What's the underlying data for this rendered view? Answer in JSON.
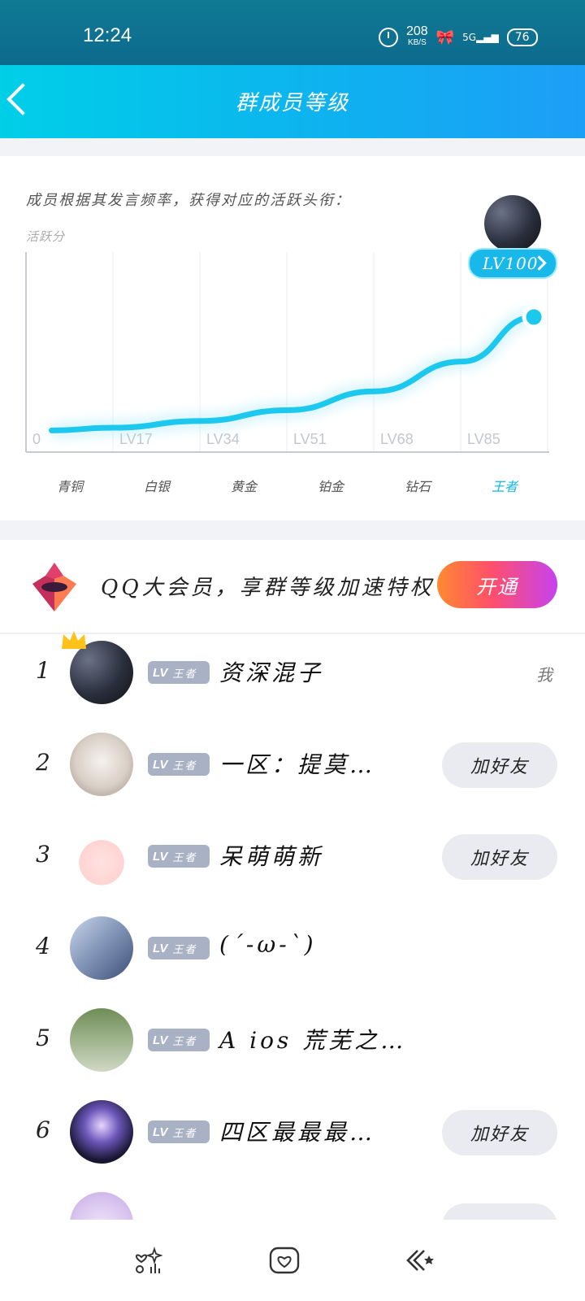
{
  "status_bar": {
    "time": "12:24",
    "net_speed": "208",
    "net_unit": "KB/S",
    "network": "5G",
    "battery": "76"
  },
  "header": {
    "title": "群成员等级"
  },
  "chart_section": {
    "description": "成员根据其发言频率，获得对应的活跃头衔：",
    "badge": "LV100"
  },
  "chart_data": {
    "type": "line",
    "ylabel": "活跃分",
    "x_tick_labels": [
      "0",
      "LV17",
      "LV34",
      "LV51",
      "LV68",
      "LV85"
    ],
    "categories": [
      "青铜",
      "白银",
      "黄金",
      "铂金",
      "钻石",
      "王者"
    ],
    "active_category": "王者",
    "x": [
      5,
      17,
      34,
      51,
      68,
      85,
      99
    ],
    "y": [
      1,
      3,
      8,
      16,
      30,
      52,
      85
    ],
    "xlim": [
      0,
      102
    ],
    "ylim": [
      0,
      100
    ],
    "grid": "vertical",
    "endpoint_label": "LV100",
    "colors": {
      "line": "#1cc8ee",
      "active": "#10b7e6"
    }
  },
  "vip": {
    "text": "QQ大会员，享群等级加速特权",
    "button": "开通"
  },
  "members": [
    {
      "rank": "1",
      "level": "LV",
      "title": "王者",
      "name": "资深混子",
      "action": "我",
      "self": true
    },
    {
      "rank": "2",
      "level": "LV",
      "title": "王者",
      "name": "一区：提莫…",
      "action": "加好友",
      "self": false
    },
    {
      "rank": "3",
      "level": "LV",
      "title": "王者",
      "name": "呆萌萌新",
      "action": "加好友",
      "self": false
    },
    {
      "rank": "4",
      "level": "LV",
      "title": "王者",
      "name": "(´-ω-`)",
      "action": "",
      "self": false
    },
    {
      "rank": "5",
      "level": "LV",
      "title": "王者",
      "name": "A ios 荒芜之…",
      "action": "",
      "self": false
    },
    {
      "rank": "6",
      "level": "LV",
      "title": "王者",
      "name": "四区最最最…",
      "action": "加好友",
      "self": false
    }
  ],
  "bottom_nav": [
    "heart-sparkle-icon",
    "photo-heart-icon",
    "double-chevron-star-icon"
  ]
}
